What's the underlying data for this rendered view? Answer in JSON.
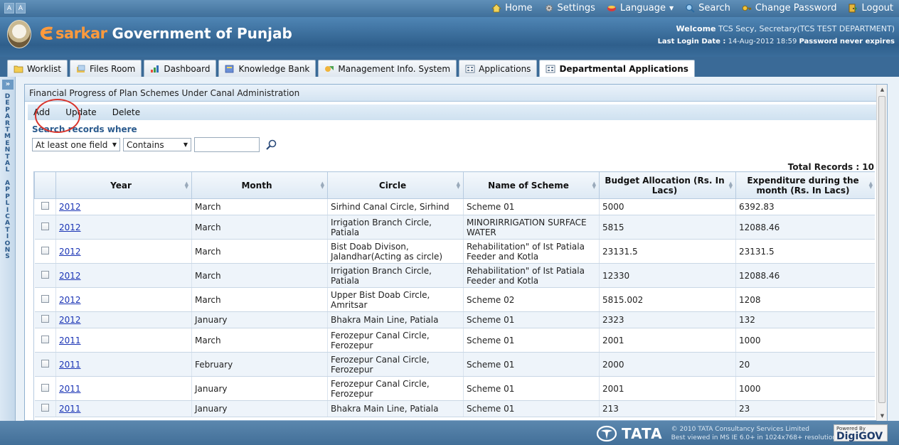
{
  "topbar": {
    "font_small": "A",
    "font_large": "A",
    "nav": {
      "home": "Home",
      "settings": "Settings",
      "language": "Language",
      "search": "Search",
      "change_password": "Change Password",
      "logout": "Logout"
    }
  },
  "header": {
    "brand_sarkar": "sarkar",
    "title": "Government of Punjab",
    "welcome_label": "Welcome",
    "welcome_user": "TCS Secy, Secretary(TCS TEST DEPARTMENT)",
    "last_login_label": "Last Login Date :",
    "last_login_value": "14-Aug-2012 18:59",
    "password_note": "Password never expires"
  },
  "tabs": [
    {
      "label": "Worklist",
      "icon": "folder-icon"
    },
    {
      "label": "Files Room",
      "icon": "files-icon"
    },
    {
      "label": "Dashboard",
      "icon": "chart-icon"
    },
    {
      "label": "Knowledge Bank",
      "icon": "book-icon"
    },
    {
      "label": "Management Info. System",
      "icon": "mis-icon"
    },
    {
      "label": "Applications",
      "icon": "app-icon"
    },
    {
      "label": "Departmental Applications",
      "icon": "app-icon",
      "active": true
    }
  ],
  "sidebar": {
    "toggle": "»",
    "word1": [
      "D",
      "E",
      "P",
      "A",
      "R",
      "T",
      "M",
      "E",
      "N",
      "T",
      "A",
      "L"
    ],
    "word2": [
      "A",
      "P",
      "P",
      "L",
      "I",
      "C",
      "A",
      "T",
      "I",
      "O",
      "N",
      "S"
    ]
  },
  "panel": {
    "title": "Financial Progress of Plan Schemes Under Canal Administration",
    "actions": {
      "add": "Add",
      "update": "Update",
      "delete": "Delete"
    },
    "search_label": "Search records where",
    "filter_field": "At least one field",
    "filter_op": "Contains",
    "search_value": "",
    "total_records": "Total Records : 10"
  },
  "table": {
    "columns": [
      "Year",
      "Month",
      "Circle",
      "Name of Scheme",
      "Budget Allocation (Rs. In Lacs)",
      "Expenditure during the month (Rs. In Lacs)"
    ],
    "rows": [
      {
        "year": "2012",
        "month": "March",
        "circle": "Sirhind Canal Circle, Sirhind",
        "scheme": "Scheme 01",
        "budget": "5000",
        "expenditure": "6392.83"
      },
      {
        "year": "2012",
        "month": "March",
        "circle": "Irrigation Branch Circle, Patiala",
        "scheme": "MINORIRRIGATION SURFACE WATER",
        "budget": "5815",
        "expenditure": "12088.46"
      },
      {
        "year": "2012",
        "month": "March",
        "circle": "Bist Doab Divison, Jalandhar(Acting as circle)",
        "scheme": "Rehabilitation\" of Ist Patiala Feeder and Kotla",
        "budget": "23131.5",
        "expenditure": "23131.5"
      },
      {
        "year": "2012",
        "month": "March",
        "circle": "Irrigation Branch Circle, Patiala",
        "scheme": "Rehabilitation\" of Ist Patiala Feeder and Kotla",
        "budget": "12330",
        "expenditure": "12088.46"
      },
      {
        "year": "2012",
        "month": "March",
        "circle": "Upper Bist Doab Circle, Amritsar",
        "scheme": "Scheme 02",
        "budget": "5815.002",
        "expenditure": "1208"
      },
      {
        "year": "2012",
        "month": "January",
        "circle": "Bhakra Main Line, Patiala",
        "scheme": "Scheme 01",
        "budget": "2323",
        "expenditure": "132"
      },
      {
        "year": "2011",
        "month": "March",
        "circle": "Ferozepur Canal Circle, Ferozepur",
        "scheme": "Scheme 01",
        "budget": "2001",
        "expenditure": "1000"
      },
      {
        "year": "2011",
        "month": "February",
        "circle": "Ferozepur Canal Circle, Ferozepur",
        "scheme": "Scheme 01",
        "budget": "2000",
        "expenditure": "20"
      },
      {
        "year": "2011",
        "month": "January",
        "circle": "Ferozepur Canal Circle, Ferozepur",
        "scheme": "Scheme 01",
        "budget": "2001",
        "expenditure": "1000"
      },
      {
        "year": "2011",
        "month": "January",
        "circle": "Bhakra Main Line, Patiala",
        "scheme": "Scheme 01",
        "budget": "213",
        "expenditure": "23"
      }
    ]
  },
  "footer": {
    "tata": "TATA",
    "copyright": "© 2010 TATA Consultancy Services Limited",
    "resolution": "Best viewed in MS IE 6.0+ in 1024x768+ resolution",
    "powered_by": "Powered By",
    "digigov": "DigiGOV",
    "tm": "TM"
  },
  "colors": {
    "accent": "#3a6a97",
    "link": "#1a34b5",
    "annotation_circle": "#d8342c"
  }
}
